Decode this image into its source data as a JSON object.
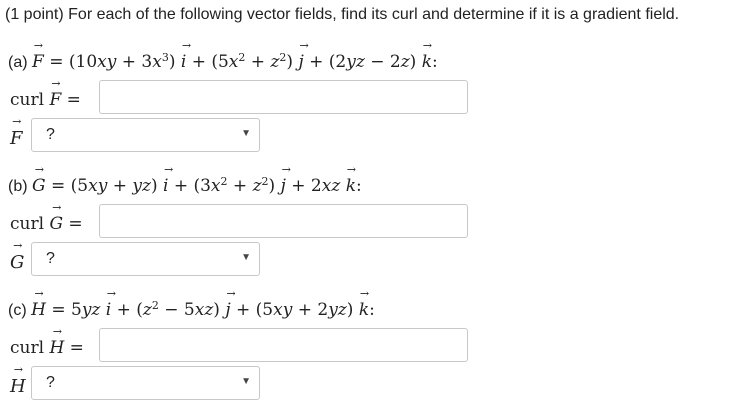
{
  "intro": "(1 point) For each of the following vector fields, find its curl and determine if it is a gradient field.",
  "problems": [
    {
      "label": "(a)",
      "var": "F",
      "equation": "= (10xy + 3x³) i + (5x² + z²) j + (2yz − 2z) k:",
      "curl_label": "curl F =",
      "curl_value": "",
      "select_value": "?"
    },
    {
      "label": "(b)",
      "var": "G",
      "equation": "= (5xy + yz) i + (3x² + z²) j + 2xz k:",
      "curl_label": "curl G =",
      "curl_value": "",
      "select_value": "?"
    },
    {
      "label": "(c)",
      "var": "H",
      "equation": "= 5yz i + (z² − 5xz) j + (5xy + 2yz) k:",
      "curl_label": "curl H =",
      "curl_value": "",
      "select_value": "?"
    }
  ],
  "icons": {
    "dropdown": "caret-down-icon"
  }
}
